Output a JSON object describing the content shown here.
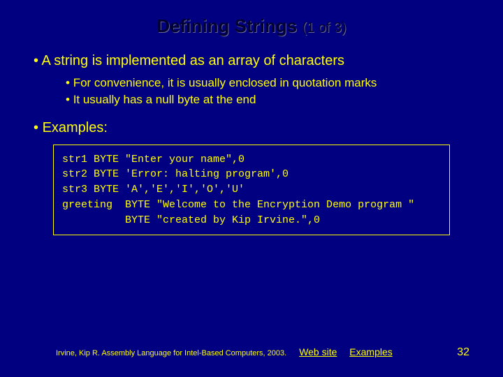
{
  "title": {
    "main": "Defining Strings",
    "sub": "(1 of 3)"
  },
  "bullets": {
    "b1": "A string is implemented as an array of characters",
    "b1a": "For convenience, it is usually enclosed in quotation marks",
    "b1b": "It usually has a null byte at the end",
    "b2": "Examples:"
  },
  "code": "str1 BYTE \"Enter your name\",0\nstr2 BYTE 'Error: halting program',0\nstr3 BYTE 'A','E','I','O','U'\ngreeting  BYTE \"Welcome to the Encryption Demo program \"\n          BYTE \"created by Kip Irvine.\",0",
  "footer": {
    "citation": "Irvine, Kip R. Assembly Language for Intel-Based Computers, 2003.",
    "link_web": "Web site",
    "link_examples": "Examples",
    "page": "32"
  }
}
